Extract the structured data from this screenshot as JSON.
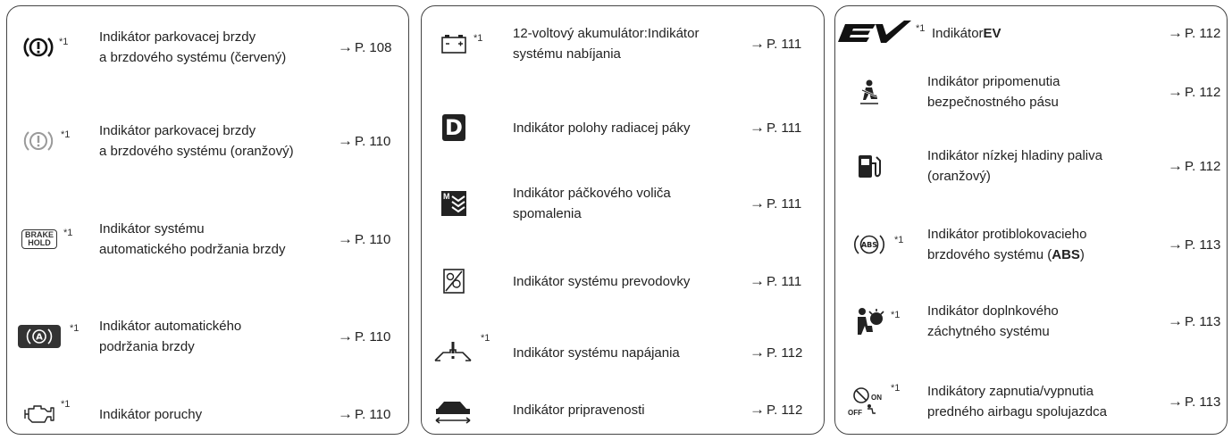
{
  "col1": [
    {
      "sup": "*1",
      "label": "Indikátor parkovacej brzdy\na brzdového systému (červený)",
      "ref": "P. 108",
      "icon": "brake-system-red-icon"
    },
    {
      "sup": "*1",
      "label": "Indikátor parkovacej brzdy\na brzdového systému (oranžový)",
      "ref": "P. 110",
      "icon": "brake-system-amber-icon"
    },
    {
      "sup": "*1",
      "label": "Indikátor systému\nautomatického podržania brzdy",
      "ref": "P. 110",
      "icon": "brake-hold-icon",
      "icon_text": [
        "BRAKE",
        "HOLD"
      ]
    },
    {
      "sup": "*1",
      "label": "Indikátor automatického\npodržania brzdy",
      "ref": "P. 110",
      "icon": "auto-brake-hold-icon",
      "icon_text": "A"
    },
    {
      "sup": "*1",
      "label": "Indikátor poruchy",
      "ref": "P. 110",
      "icon": "engine-malfunction-icon"
    }
  ],
  "col2": [
    {
      "sup": "*1",
      "label": "12-voltový akumulátor:Indikátor\nsystému nabíjania",
      "ref": "P. 111",
      "icon": "battery-icon"
    },
    {
      "sup": "",
      "label": "Indikátor polohy radiacej páky",
      "ref": "P. 111",
      "icon": "shift-position-d-icon",
      "icon_text": "D"
    },
    {
      "sup": "",
      "label": "Indikátor páčkového voliča\nspomalenia",
      "ref": "P. 111",
      "icon": "deceleration-selector-icon",
      "icon_text": "M"
    },
    {
      "sup": "",
      "label": "Indikátor systému prevodovky",
      "ref": "P. 111",
      "icon": "transmission-system-icon"
    },
    {
      "sup": "*1",
      "label": "Indikátor systému napájania",
      "ref": "P. 112",
      "icon": "power-system-icon"
    },
    {
      "sup": "",
      "label": "Indikátor pripravenosti",
      "ref": "P. 112",
      "icon": "ready-car-icon"
    }
  ],
  "col3": [
    {
      "sup": "*1",
      "label_pre": "Indikátor ",
      "label_bold": "EV",
      "label_post": "",
      "ref": "P. 112",
      "icon": "ev-icon"
    },
    {
      "sup": "",
      "label": "Indikátor pripomenutia\nbezpečnostného pásu",
      "ref": "P. 112",
      "icon": "seatbelt-reminder-icon"
    },
    {
      "sup": "",
      "label": "Indikátor nízkej hladiny paliva\n(oranžový)",
      "ref": "P. 112",
      "icon": "low-fuel-icon"
    },
    {
      "sup": "*1",
      "label_pre": "Indikátor protiblokovacieho\nbrzdového systému (",
      "label_bold": "ABS",
      "label_post": ")",
      "ref": "P. 113",
      "icon": "abs-icon",
      "icon_text": "ABS"
    },
    {
      "sup": "*1",
      "label": "Indikátor doplnkového\nzáchytného systému",
      "ref": "P. 113",
      "icon": "airbag-srs-icon"
    },
    {
      "sup": "*1",
      "label": "Indikátory zapnutia/vypnutia\npredného airbagu spolujazdca",
      "ref": "P. 113",
      "icon": "passenger-airbag-on-off-icon",
      "icon_text": [
        "ON",
        "OFF"
      ]
    }
  ],
  "arrow": "→",
  "colors": {
    "red_indicator": "#222222",
    "amber_indicator": "#9a9a9a",
    "border": "#444444"
  }
}
